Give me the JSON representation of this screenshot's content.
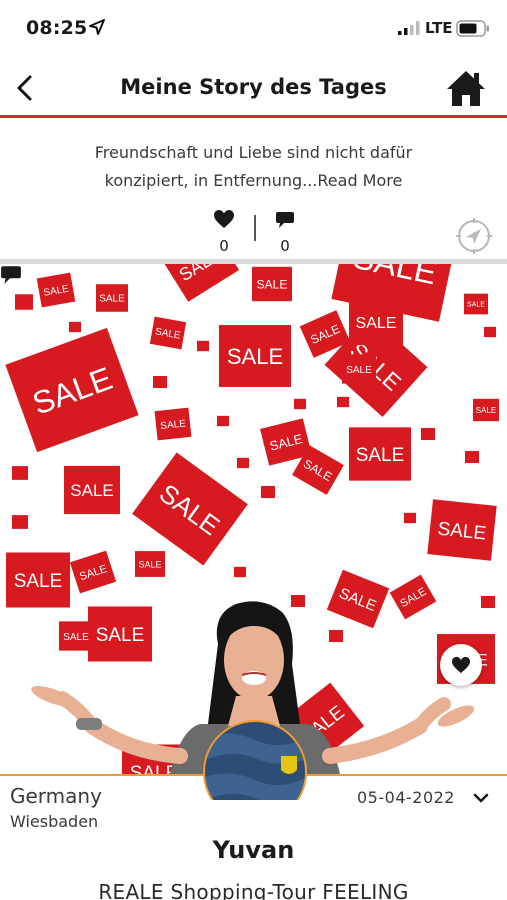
{
  "status_bar": {
    "time": "08:25",
    "network": "LTE",
    "icons": [
      "location-arrow-icon",
      "signal-bars-icon",
      "battery-icon"
    ]
  },
  "header": {
    "title": "Meine Story des Tages",
    "back_icon": "chevron-left-icon",
    "home_icon": "home-icon",
    "accent_color": "#d42b2b"
  },
  "story": {
    "excerpt_line1": "Freundschaft und Liebe sind nicht dafür",
    "excerpt_line2": "konzipiert, in Entfernung...",
    "read_more": "Read More"
  },
  "actions": {
    "likes": "0",
    "comments": "0",
    "icons": [
      "heart-icon",
      "comment-icon",
      "compass-icon"
    ]
  },
  "photo": {
    "sign_text": "SALE",
    "sale_red": "#d71920",
    "overlay_icons": [
      "heart-icon",
      "comment-icon"
    ]
  },
  "post": {
    "country": "Germany",
    "city": "Wiesbaden",
    "date": "05-04-2022",
    "user": "Yuvan",
    "title": "REALE Shopping-Tour FEELING",
    "divider_color": "#f29b2f"
  }
}
